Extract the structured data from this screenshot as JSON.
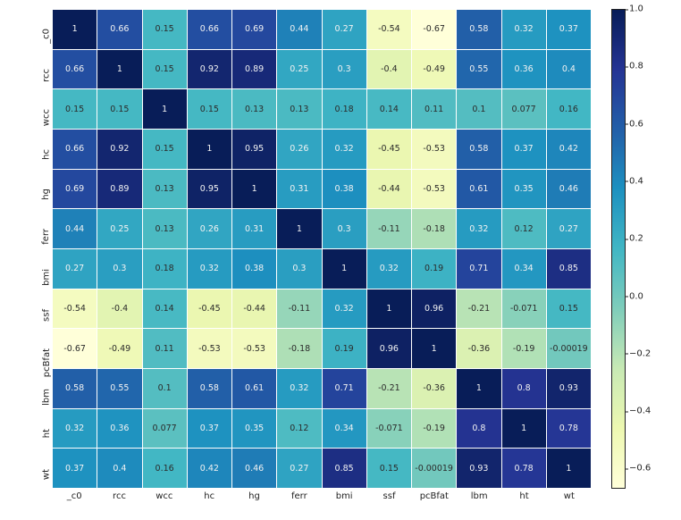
{
  "chart_data": {
    "type": "heatmap",
    "labels": [
      "_c0",
      "rcc",
      "wcc",
      "hc",
      "hg",
      "ferr",
      "bmi",
      "ssf",
      "pcBfat",
      "lbm",
      "ht",
      "wt"
    ],
    "matrix": [
      [
        1,
        0.66,
        0.15,
        0.66,
        0.69,
        0.44,
        0.27,
        -0.54,
        -0.67,
        0.58,
        0.32,
        0.37
      ],
      [
        0.66,
        1,
        0.15,
        0.92,
        0.89,
        0.25,
        0.3,
        -0.4,
        -0.49,
        0.55,
        0.36,
        0.4
      ],
      [
        0.15,
        0.15,
        1,
        0.15,
        0.13,
        0.13,
        0.18,
        0.14,
        0.11,
        0.1,
        0.077,
        0.16
      ],
      [
        0.66,
        0.92,
        0.15,
        1,
        0.95,
        0.26,
        0.32,
        -0.45,
        -0.53,
        0.58,
        0.37,
        0.42
      ],
      [
        0.69,
        0.89,
        0.13,
        0.95,
        1,
        0.31,
        0.38,
        -0.44,
        -0.53,
        0.61,
        0.35,
        0.46
      ],
      [
        0.44,
        0.25,
        0.13,
        0.26,
        0.31,
        1,
        0.3,
        -0.11,
        -0.18,
        0.32,
        0.12,
        0.27
      ],
      [
        0.27,
        0.3,
        0.18,
        0.32,
        0.38,
        0.3,
        1,
        0.32,
        0.19,
        0.71,
        0.34,
        0.85
      ],
      [
        -0.54,
        -0.4,
        0.14,
        -0.45,
        -0.44,
        -0.11,
        0.32,
        1,
        0.96,
        -0.21,
        -0.071,
        0.15
      ],
      [
        -0.67,
        -0.49,
        0.11,
        -0.53,
        -0.53,
        -0.18,
        0.19,
        0.96,
        1,
        -0.36,
        -0.19,
        -0.00019
      ],
      [
        0.58,
        0.55,
        0.1,
        0.58,
        0.61,
        0.32,
        0.71,
        -0.21,
        -0.36,
        1,
        0.8,
        0.93
      ],
      [
        0.32,
        0.36,
        0.077,
        0.37,
        0.35,
        0.12,
        0.34,
        -0.071,
        -0.19,
        0.8,
        1,
        0.78
      ],
      [
        0.37,
        0.4,
        0.16,
        0.42,
        0.46,
        0.27,
        0.85,
        0.15,
        -0.00019,
        0.93,
        0.78,
        1
      ]
    ],
    "cell_labels": [
      [
        "1",
        "0.66",
        "0.15",
        "0.66",
        "0.69",
        "0.44",
        "0.27",
        "-0.54",
        "-0.67",
        "0.58",
        "0.32",
        "0.37"
      ],
      [
        "0.66",
        "1",
        "0.15",
        "0.92",
        "0.89",
        "0.25",
        "0.3",
        "-0.4",
        "-0.49",
        "0.55",
        "0.36",
        "0.4"
      ],
      [
        "0.15",
        "0.15",
        "1",
        "0.15",
        "0.13",
        "0.13",
        "0.18",
        "0.14",
        "0.11",
        "0.1",
        "0.077",
        "0.16"
      ],
      [
        "0.66",
        "0.92",
        "0.15",
        "1",
        "0.95",
        "0.26",
        "0.32",
        "-0.45",
        "-0.53",
        "0.58",
        "0.37",
        "0.42"
      ],
      [
        "0.69",
        "0.89",
        "0.13",
        "0.95",
        "1",
        "0.31",
        "0.38",
        "-0.44",
        "-0.53",
        "0.61",
        "0.35",
        "0.46"
      ],
      [
        "0.44",
        "0.25",
        "0.13",
        "0.26",
        "0.31",
        "1",
        "0.3",
        "-0.11",
        "-0.18",
        "0.32",
        "0.12",
        "0.27"
      ],
      [
        "0.27",
        "0.3",
        "0.18",
        "0.32",
        "0.38",
        "0.3",
        "1",
        "0.32",
        "0.19",
        "0.71",
        "0.34",
        "0.85"
      ],
      [
        "-0.54",
        "-0.4",
        "0.14",
        "-0.45",
        "-0.44",
        "-0.11",
        "0.32",
        "1",
        "0.96",
        "-0.21",
        "-0.071",
        "0.15"
      ],
      [
        "-0.67",
        "-0.49",
        "0.11",
        "-0.53",
        "-0.53",
        "-0.18",
        "0.19",
        "0.96",
        "1",
        "-0.36",
        "-0.19",
        "-0.00019"
      ],
      [
        "0.58",
        "0.55",
        "0.1",
        "0.58",
        "0.61",
        "0.32",
        "0.71",
        "-0.21",
        "-0.36",
        "1",
        "0.8",
        "0.93"
      ],
      [
        "0.32",
        "0.36",
        "0.077",
        "0.37",
        "0.35",
        "0.12",
        "0.34",
        "-0.071",
        "-0.19",
        "0.8",
        "1",
        "0.78"
      ],
      [
        "0.37",
        "0.4",
        "0.16",
        "0.42",
        "0.46",
        "0.27",
        "0.85",
        "0.15",
        "-0.00019",
        "0.93",
        "0.78",
        "1"
      ]
    ],
    "vmin": -0.67,
    "vmax": 1.0,
    "colorbar_ticks": [
      -0.6,
      -0.4,
      -0.2,
      0.0,
      0.2,
      0.4,
      0.6,
      0.8,
      1.0
    ],
    "colorbar_tick_labels": [
      "−0.6",
      "−0.4",
      "−0.2",
      "0.0",
      "0.2",
      "0.4",
      "0.6",
      "0.8",
      "1.0"
    ],
    "cmap": "YlGnBu"
  }
}
